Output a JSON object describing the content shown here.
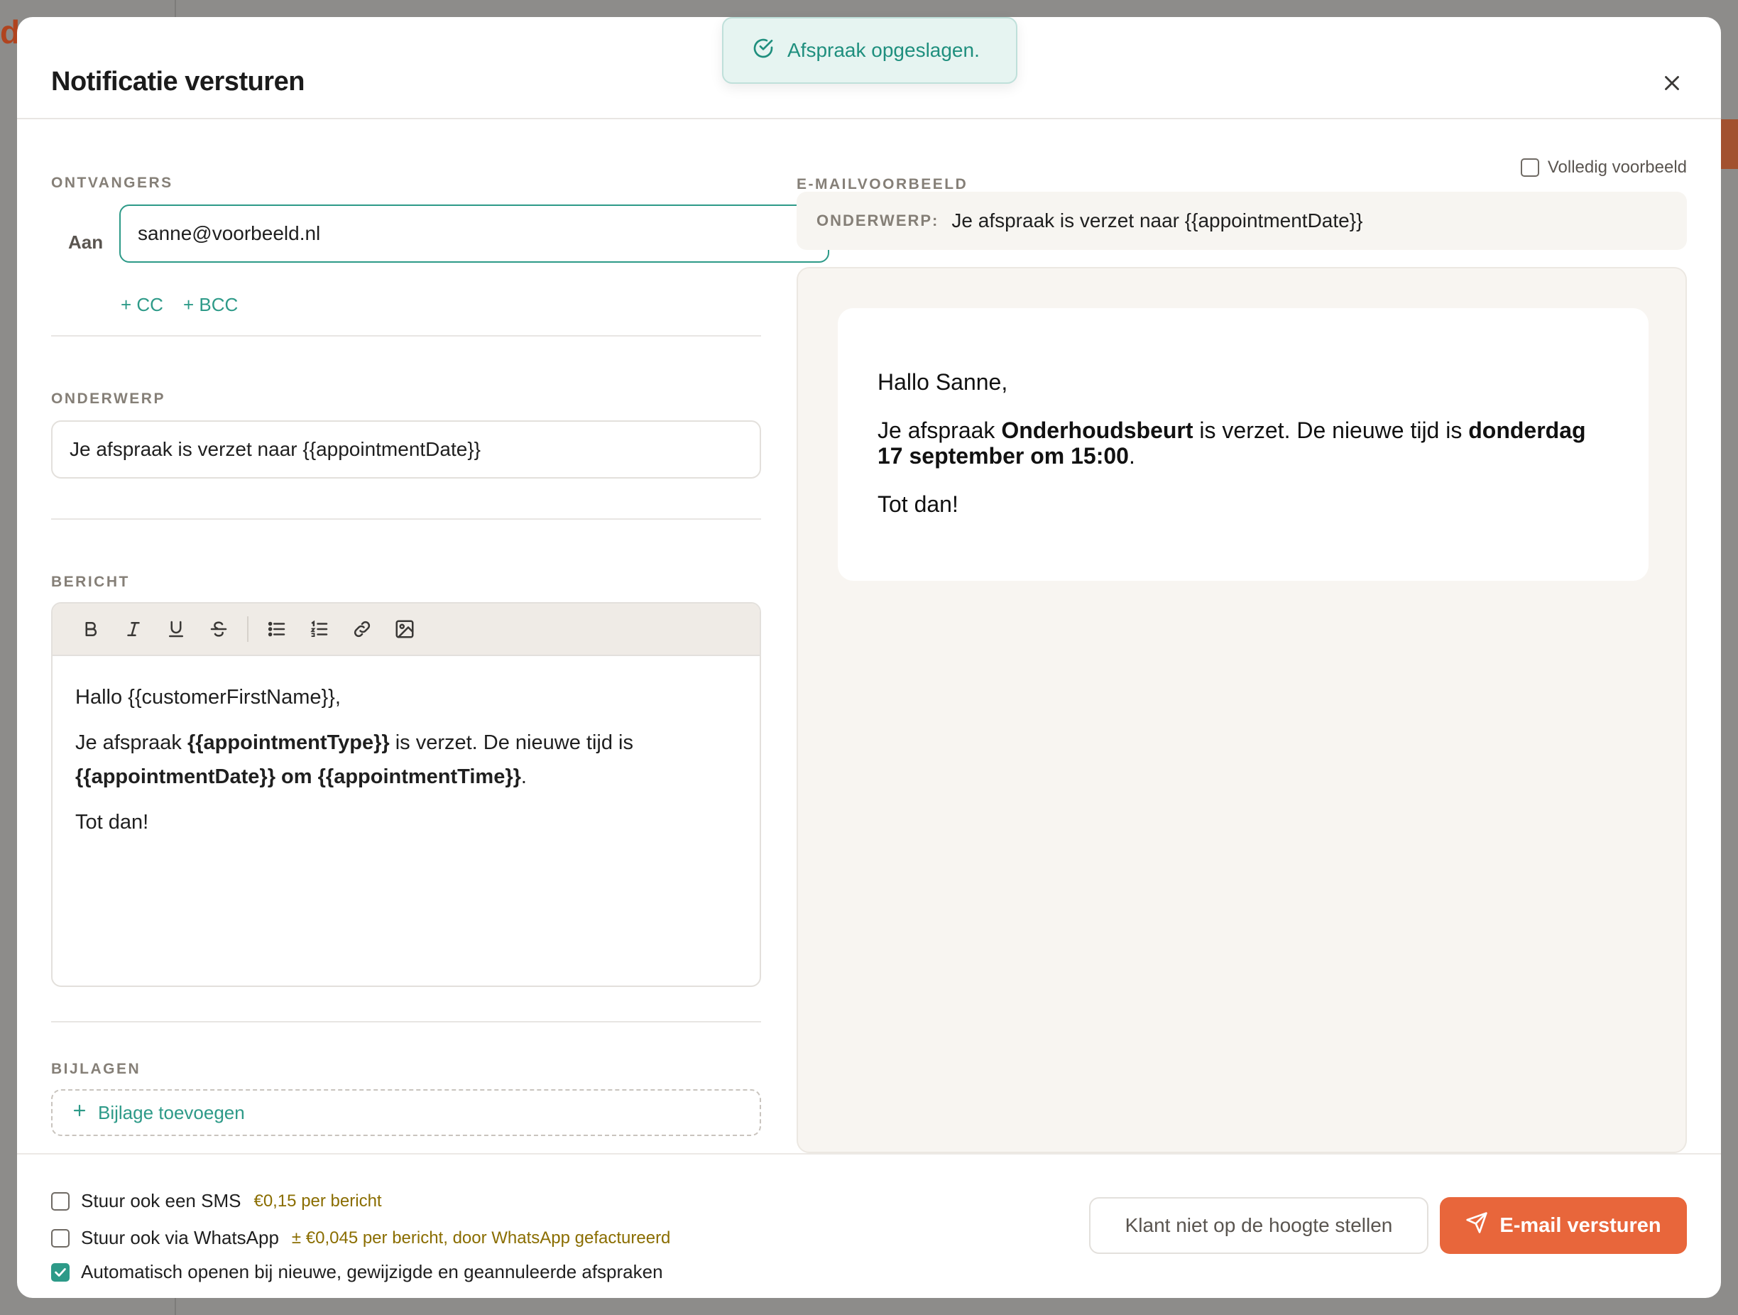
{
  "colors": {
    "accent": "#2d9a88",
    "primary_button": "#e8663b",
    "price_text": "#8a6d00"
  },
  "toast": {
    "icon": "check-circle-icon",
    "message": "Afspraak opgeslagen."
  },
  "modal": {
    "title": "Notificatie versturen",
    "close_icon": "close-icon"
  },
  "recipients": {
    "section_label": "ONTVANGERS",
    "to_label": "Aan",
    "to_value": "sanne@voorbeeld.nl",
    "cc_label": "+ CC",
    "bcc_label": "+ BCC"
  },
  "subject": {
    "section_label": "ONDERWERP",
    "value": "Je afspraak is verzet naar {{appointmentDate}}"
  },
  "message": {
    "section_label": "BERICHT",
    "toolbar": [
      "bold-icon",
      "italic-icon",
      "underline-icon",
      "strikethrough-icon",
      "bullet-list-icon",
      "numbered-list-icon",
      "link-icon",
      "image-icon"
    ],
    "greeting": "Hallo {{customerFirstName}},",
    "line_prefix": "Je afspraak ",
    "appointment_type": "{{appointmentType}}",
    "line_middle": " is verzet. De nieuwe tijd is",
    "appointment_date": "{{appointmentDate}}",
    "om": " om ",
    "appointment_time": "{{appointmentTime}}",
    "period": ".",
    "closing": "Tot dan!"
  },
  "attachments": {
    "section_label": "BIJLAGEN",
    "add_label": "Bijlage toevoegen"
  },
  "preview": {
    "section_label": "E-MAILVOORBEELD",
    "full_preview_label": "Volledig voorbeeld",
    "subject_label": "ONDERWERP:",
    "subject_value": "Je afspraak is verzet naar {{appointmentDate}}",
    "greeting": "Hallo Sanne,",
    "line_prefix": "Je afspraak ",
    "appointment_type": "Onderhoudsbeurt",
    "line_middle": " is verzet. De nieuwe tijd is ",
    "datetime": "donderdag 17 september om 15:00",
    "period": ".",
    "closing": "Tot dan!"
  },
  "footer": {
    "sms_label": "Stuur ook een SMS",
    "sms_price": "€0,15 per bericht",
    "sms_checked": false,
    "whatsapp_label": "Stuur ook via WhatsApp",
    "whatsapp_price": "± €0,045 per bericht, door WhatsApp gefactureerd",
    "whatsapp_checked": false,
    "auto_open_label": "Automatisch openen bij nieuwe, gewijzigde en geannuleerde afspraken",
    "auto_open_checked": true,
    "skip_button": "Klant niet op de hoogte stellen",
    "send_button": "E-mail versturen",
    "send_icon": "send-icon"
  }
}
